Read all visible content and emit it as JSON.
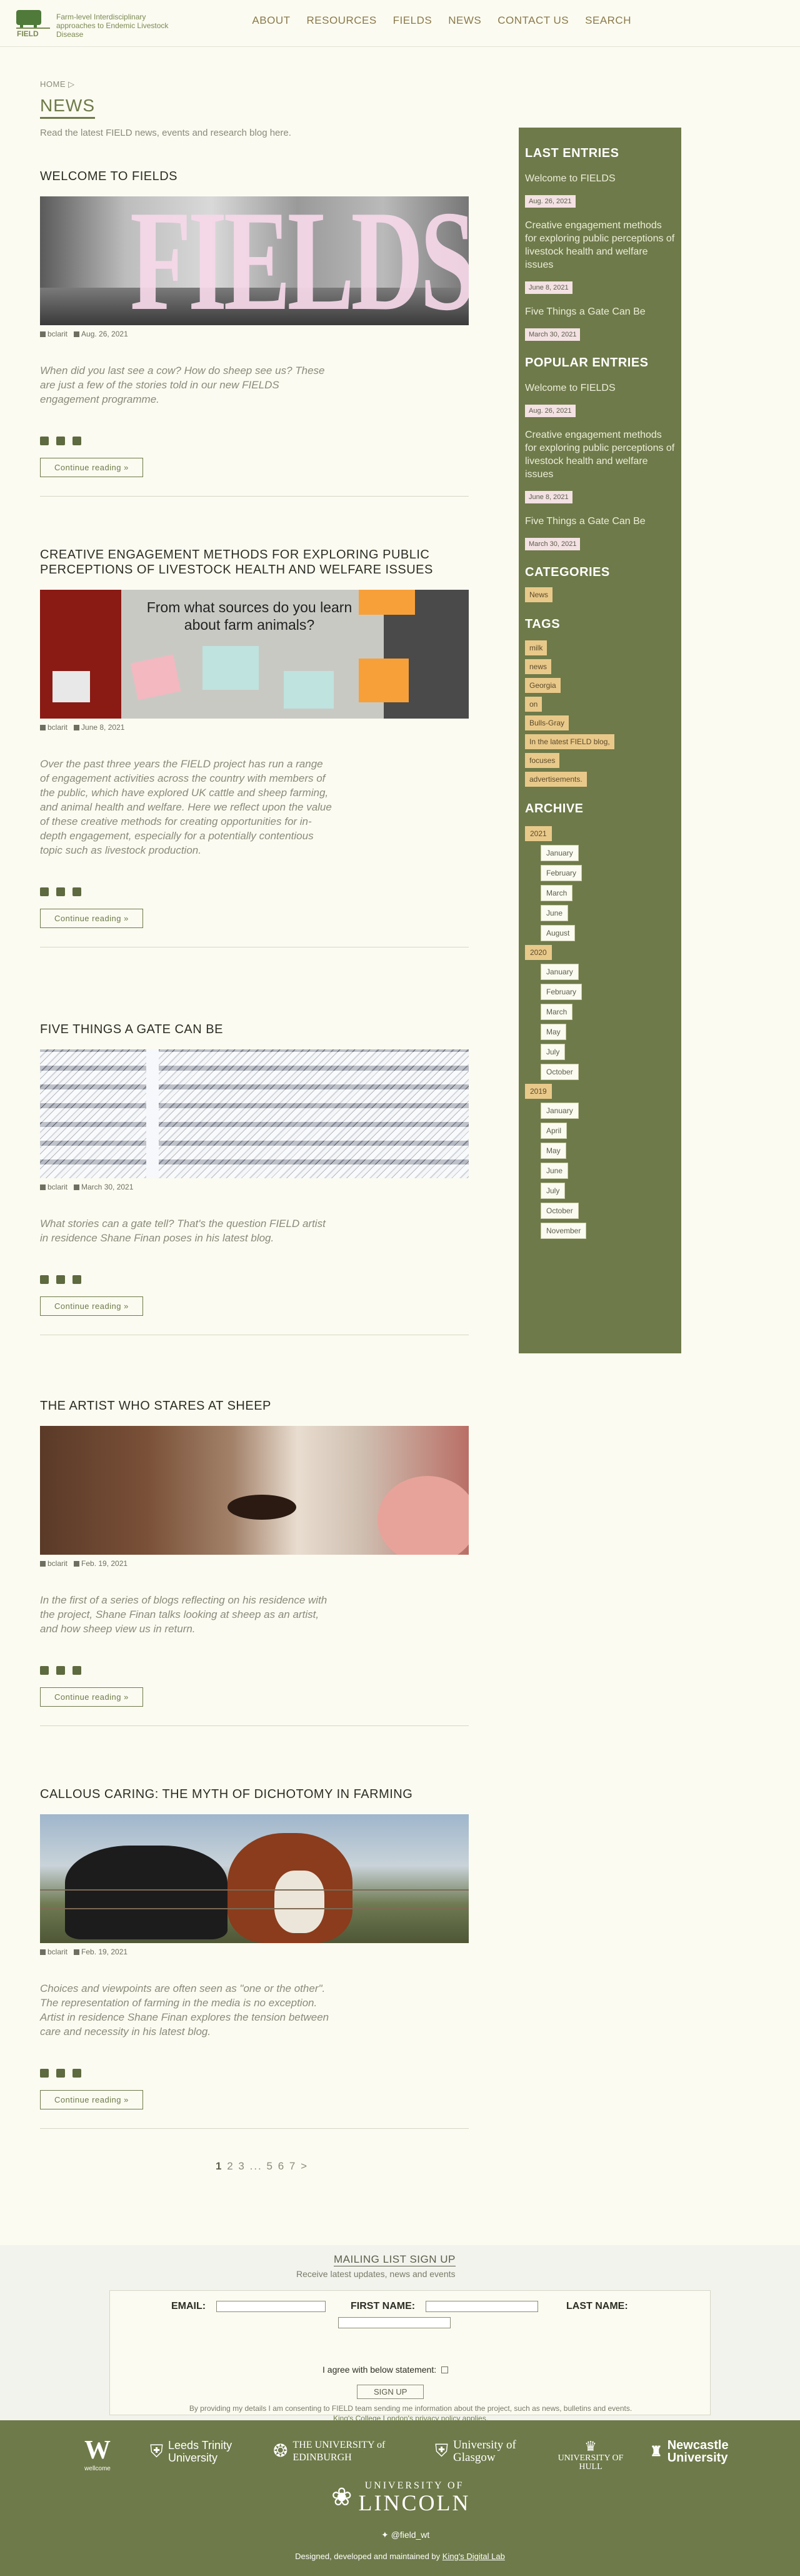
{
  "header": {
    "logo_text": "FIELD",
    "tagline": "Farm-level Interdisciplinary approaches to Endemic Livestock Disease",
    "nav": [
      "ABOUT",
      "RESOURCES",
      "FIELDS",
      "NEWS",
      "CONTACT US",
      "SEARCH"
    ]
  },
  "breadcrumb": "HOME ▷",
  "page_title": "NEWS",
  "intro": "Read the latest FIELD news, events and research blog here.",
  "posts": [
    {
      "title": "WELCOME TO FIELDS",
      "author": "bclarit",
      "date": "Aug. 26, 2021",
      "excerpt": "When did you last see a cow? How do sheep see us? These are just a few of the stories told in our new FIELDS engagement programme.",
      "button": "Continue reading »",
      "overlay": "FIELDS"
    },
    {
      "title": "CREATIVE ENGAGEMENT METHODS FOR EXPLORING PUBLIC PERCEPTIONS OF LIVESTOCK HEALTH AND WELFARE ISSUES",
      "author": "bclarit",
      "date": "June 8, 2021",
      "excerpt": "Over the past three years the FIELD project has run a range of engagement activities across the country with members of the public, which have explored UK cattle and sheep farming, and animal health and welfare. Here we reflect upon the value of these creative methods for creating opportunities for in-depth engagement, especially for a potentially contentious topic such as livestock production.",
      "button": "Continue reading »",
      "overlay": "From what sources do you learn about farm animals?"
    },
    {
      "title": "FIVE THINGS A GATE CAN BE",
      "author": "bclarit",
      "date": "March 30, 2021",
      "excerpt": "What stories can a gate tell? That's the question FIELD artist in residence Shane Finan poses in his latest blog.",
      "button": "Continue reading »"
    },
    {
      "title": "THE ARTIST WHO STARES AT SHEEP",
      "author": "bclarit",
      "date": "Feb. 19, 2021",
      "excerpt": "In the first of a series of blogs reflecting on his residence with the project, Shane Finan talks looking at sheep as an artist, and how sheep view us in return.",
      "button": "Continue reading »"
    },
    {
      "title": "CALLOUS CARING: THE MYTH OF DICHOTOMY IN FARMING",
      "author": "bclarit",
      "date": "Feb. 19, 2021",
      "excerpt": "Choices and viewpoints are often seen as \"one or the other\". The representation of farming in the media is no exception. Artist in residence Shane Finan explores the tension between care and necessity in his latest blog.",
      "button": "Continue reading »"
    }
  ],
  "pagination": {
    "current": "1",
    "pages": [
      "2",
      "3",
      "...",
      "5",
      "6",
      "7",
      ">"
    ]
  },
  "sidebar": {
    "last_entries_title": "LAST ENTRIES",
    "last_entries": [
      {
        "title": "Welcome to FIELDS",
        "date": "Aug. 26, 2021"
      },
      {
        "title": "Creative engagement methods for exploring public perceptions of livestock health and welfare issues",
        "date": "June 8, 2021"
      },
      {
        "title": "Five Things a Gate Can Be",
        "date": "March 30, 2021"
      }
    ],
    "popular_entries_title": "POPULAR ENTRIES",
    "popular_entries": [
      {
        "title": "Welcome to FIELDS",
        "date": "Aug. 26, 2021"
      },
      {
        "title": "Creative engagement methods for exploring public perceptions of livestock health and welfare issues",
        "date": "June 8, 2021"
      },
      {
        "title": "Five Things a Gate Can Be",
        "date": "March 30, 2021"
      }
    ],
    "categories_title": "CATEGORIES",
    "categories": [
      "News"
    ],
    "tags_title": "TAGS",
    "tags": [
      "milk",
      "news",
      "Georgia",
      "on",
      "Bulls-Gray",
      "In the latest FIELD blog,",
      "focuses",
      "advertisements."
    ],
    "archive_title": "ARCHIVE",
    "archive": [
      {
        "year": "2021",
        "months": [
          "January",
          "February",
          "March",
          "June",
          "August"
        ]
      },
      {
        "year": "2020",
        "months": [
          "January",
          "February",
          "March",
          "May",
          "July",
          "October"
        ]
      },
      {
        "year": "2019",
        "months": [
          "January",
          "April",
          "May",
          "June",
          "July",
          "October",
          "November"
        ]
      }
    ]
  },
  "mailing": {
    "title": "MAILING LIST SIGN UP",
    "subtitle": "Receive latest updates, news and events",
    "email_label": "EMAIL:",
    "first_name_label": "FIRST NAME:",
    "last_name_label": "LAST NAME:",
    "agree_label": "I agree with below statement:",
    "signup_button": "SIGN UP",
    "consent_text": "By providing my details I am consenting to FIELD team sending me information about the project, such as news, bulletins and events.",
    "privacy_link": "King's College London's privacy policy applies."
  },
  "footer": {
    "partners": [
      "wellcome",
      "Leeds Trinity University",
      "THE UNIVERSITY of EDINBURGH",
      "University of Glasgow",
      "UNIVERSITY OF HULL",
      "Newcastle University"
    ],
    "lincoln_top": "UNIVERSITY OF",
    "lincoln_bottom": "LINCOLN",
    "twitter": "@field_wt",
    "credit_prefix": "Designed, developed and maintained by",
    "credit_link": "King's Digital Lab"
  },
  "colors": {
    "olive": "#6e7a49",
    "tag": "#e9c98a",
    "date_chip": "#f3e1e3"
  }
}
